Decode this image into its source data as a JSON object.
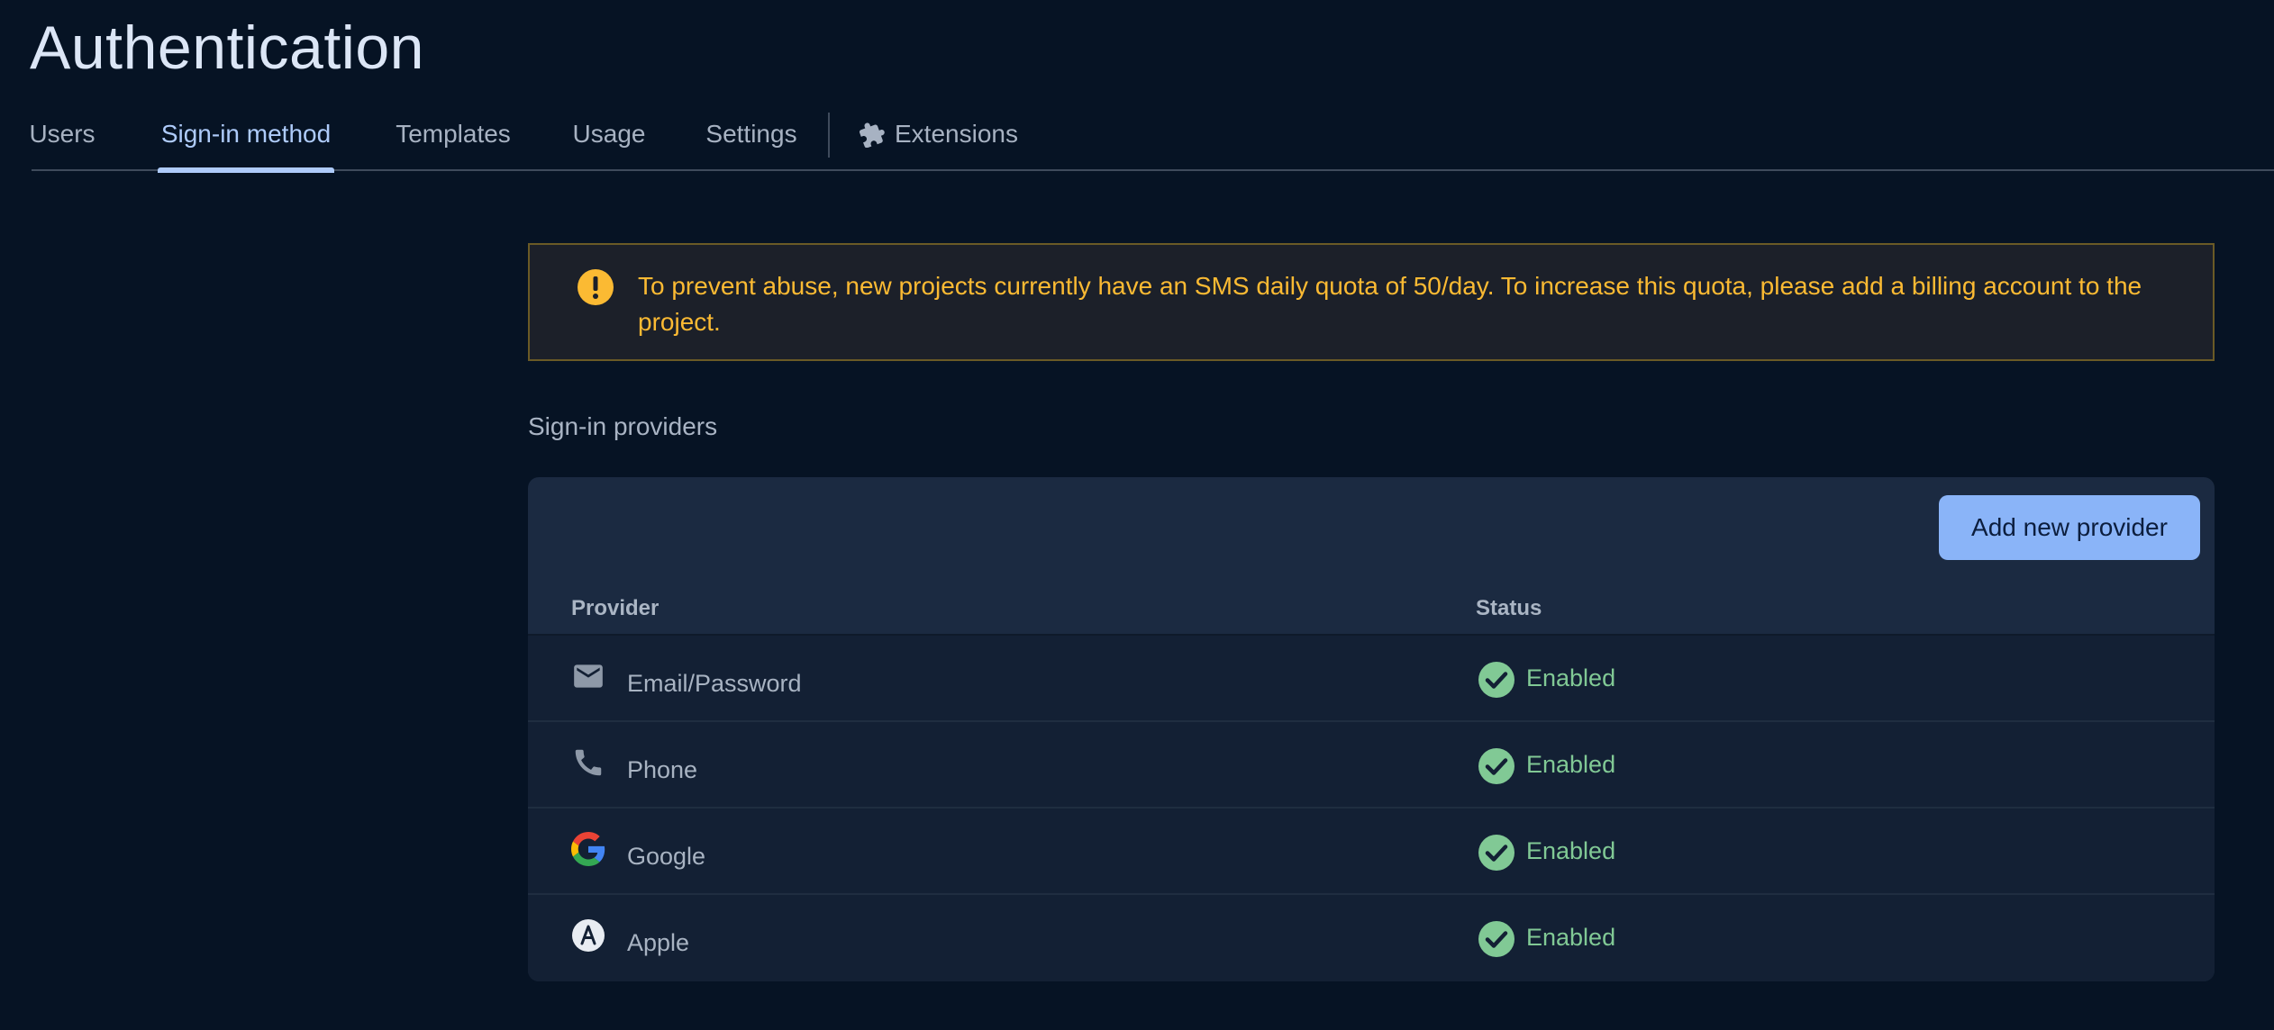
{
  "page": {
    "title": "Authentication"
  },
  "tabs": [
    {
      "label": "Users",
      "active": false
    },
    {
      "label": "Sign-in method",
      "active": true
    },
    {
      "label": "Templates",
      "active": false
    },
    {
      "label": "Usage",
      "active": false
    },
    {
      "label": "Settings",
      "active": false
    },
    {
      "label": "Extensions",
      "active": false,
      "icon": "puzzle-icon"
    }
  ],
  "alert": {
    "icon": "warning-icon",
    "text": "To prevent abuse, new projects currently have an SMS daily quota of 50/day. To increase this quota, please add a billing account to the project."
  },
  "providers_section": {
    "title": "Sign-in providers",
    "add_button": "Add new provider",
    "columns": {
      "provider": "Provider",
      "status": "Status"
    },
    "rows": [
      {
        "icon": "email-icon",
        "name": "Email/Password",
        "status": "Enabled"
      },
      {
        "icon": "phone-icon",
        "name": "Phone",
        "status": "Enabled"
      },
      {
        "icon": "google-icon",
        "name": "Google",
        "status": "Enabled"
      },
      {
        "icon": "apple-icon",
        "name": "Apple",
        "status": "Enabled"
      }
    ]
  },
  "colors": {
    "background": "#061324",
    "accent": "#8ab4f8",
    "warning": "#fbba33",
    "enabled": "#81c995"
  }
}
